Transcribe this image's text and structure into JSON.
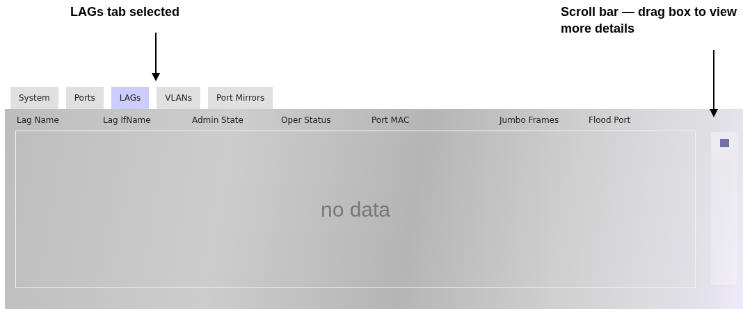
{
  "callouts": [
    {
      "text": "LAGs tab selected",
      "kind": "left"
    },
    {
      "text": "Scroll bar — drag box to view more details",
      "kind": "right"
    }
  ],
  "tabs": [
    {
      "label": "System",
      "selected": false
    },
    {
      "label": "Ports",
      "selected": false
    },
    {
      "label": "LAGs",
      "selected": true
    },
    {
      "label": "VLANs",
      "selected": false
    },
    {
      "label": "Port Mirrors",
      "selected": false
    }
  ],
  "table": {
    "columns": [
      "Lag Name",
      "Lag IfName",
      "Admin State",
      "Oper Status",
      "Port MAC",
      "Jumbo Frames",
      "Flood Port"
    ],
    "empty_message": "no data"
  }
}
